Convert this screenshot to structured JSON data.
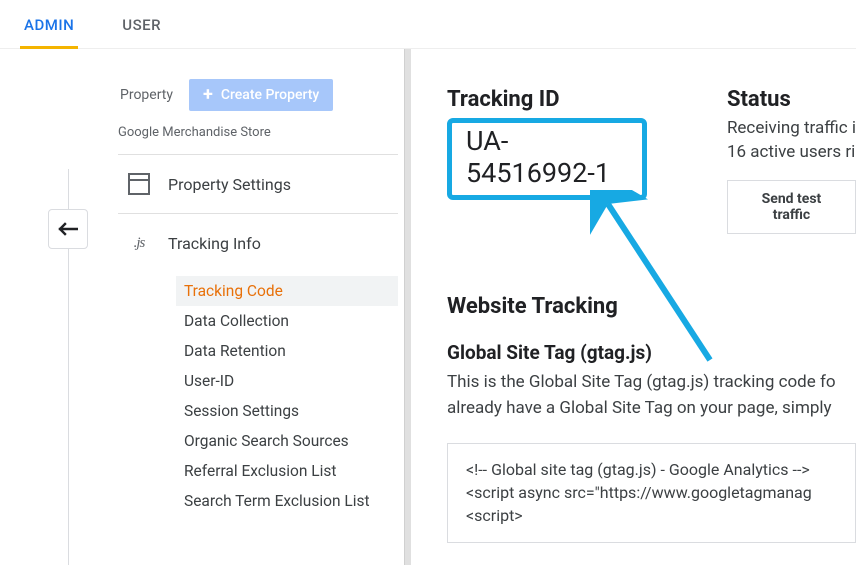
{
  "tabs": {
    "admin": "ADMIN",
    "user": "USER"
  },
  "sidebar": {
    "property_label": "Property",
    "create_btn": "Create Property",
    "store_name": "Google Merchandise Store",
    "property_settings": "Property Settings",
    "tracking_info": "Tracking Info",
    "sub": {
      "tracking_code": "Tracking Code",
      "data_collection": "Data Collection",
      "data_retention": "Data Retention",
      "user_id": "User-ID",
      "session_settings": "Session Settings",
      "organic_search": "Organic Search Sources",
      "referral_excl": "Referral Exclusion List",
      "search_term_excl": "Search Term Exclusion List"
    }
  },
  "main": {
    "tracking_id_label": "Tracking ID",
    "tracking_id": "UA-54516992-1",
    "status_label": "Status",
    "status_line1": "Receiving traffic i",
    "status_line2": "16 active users ri",
    "test_btn": "Send test traffic",
    "website_tracking": "Website Tracking",
    "gtag_heading": "Global Site Tag (gtag.js)",
    "gtag_desc1": "This is the Global Site Tag (gtag.js) tracking code fo",
    "gtag_desc2": "already have a Global Site Tag on your page, simply ",
    "code_line1": "<!-- Global site tag (gtag.js) - Google Analytics -->",
    "code_line2": "<script async src=\"https://www.googletagmanag",
    "code_line3": "<script>"
  }
}
